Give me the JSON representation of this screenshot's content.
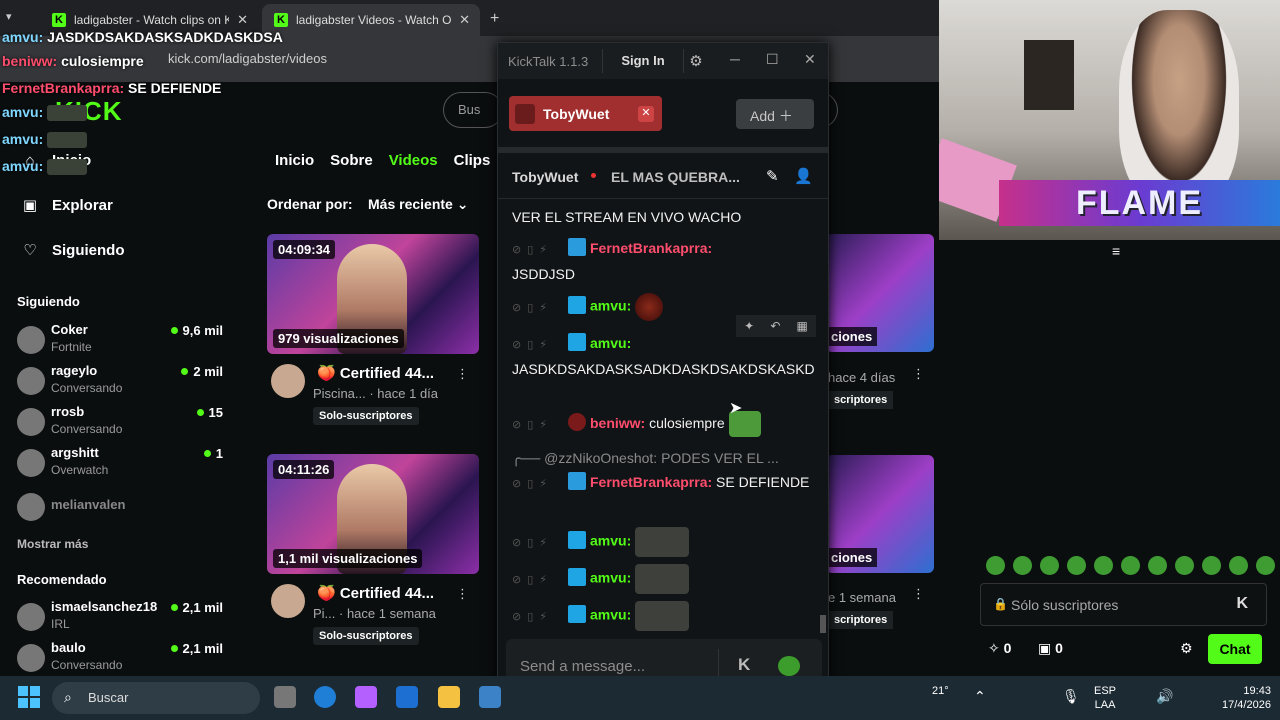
{
  "browser": {
    "tabs": [
      {
        "title": "ladigabster - Watch clips on Kic"
      },
      {
        "title": "ladigabster Videos - Watch On"
      }
    ],
    "new_tab": "+",
    "url": "kick.com/ladigabster/videos"
  },
  "overlay_chat": [
    {
      "user": "amvu:",
      "text": "JASDKDSAKDASKSADKDASKDSA"
    },
    {
      "user": "beniww:",
      "text": "culosiempre"
    },
    {
      "user": "FernetBrankaprra:",
      "text": "SE DEFIENDE"
    },
    {
      "user": "amvu:",
      "text": ""
    },
    {
      "user": "amvu:",
      "text": ""
    },
    {
      "user": "amvu:",
      "text": ""
    }
  ],
  "kick": {
    "logo": "KICK",
    "search_placeholder": "Bus",
    "nav": [
      {
        "label": "Inicio",
        "icon": "home-icon"
      },
      {
        "label": "Explorar",
        "icon": "compass-icon"
      },
      {
        "label": "Siguiendo",
        "icon": "heart-icon"
      }
    ],
    "following_header": "Siguiendo",
    "following": [
      {
        "name": "Coker",
        "sub": "Fortnite",
        "count": "9,6 mil"
      },
      {
        "name": "rageylo",
        "sub": "Conversando",
        "count": "2 mil"
      },
      {
        "name": "rrosb",
        "sub": "Conversando",
        "count": "15"
      },
      {
        "name": "argshitt",
        "sub": "Overwatch",
        "count": "1"
      },
      {
        "name": "melianvalen",
        "sub": "",
        "count": ""
      }
    ],
    "show_more": "Mostrar más",
    "recommended_header": "Recomendado",
    "recommended": [
      {
        "name": "ismaelsanchez18",
        "sub": "IRL",
        "count": "2,1 mil"
      },
      {
        "name": "baulo",
        "sub": "Conversando",
        "count": "2,1 mil"
      }
    ],
    "profile_tabs": [
      "Inicio",
      "Sobre",
      "Videos",
      "Clips"
    ],
    "sort_label": "Ordenar por:",
    "sort_value": "Más reciente",
    "videos": [
      {
        "duration": "04:09:34",
        "views": "979 visualizaciones",
        "title": "🍑 Certified 44...",
        "meta": "Piscina... · hace 1 día",
        "badge": "Solo-suscriptores"
      },
      {
        "duration": "04:11:26",
        "views": "1,1 mil visualizaciones",
        "title": "🍑 Certified 44...",
        "meta": "Pi... · hace 1 semana",
        "badge": "Solo-suscriptores"
      }
    ],
    "right_videos": [
      {
        "views": "ciones",
        "meta": "hace 4 días",
        "badge": "scriptores"
      },
      {
        "views": "ciones",
        "meta": "e 1 semana",
        "badge": "scriptores"
      }
    ]
  },
  "kicktalk": {
    "title": "KickTalk 1.1.3",
    "sign_in": "Sign In",
    "channel_tab": "TobyWuet",
    "add_label": "Add",
    "streamer": "TobyWuet",
    "stream_title": "EL MAS QUEBRA...",
    "messages": [
      {
        "text": "VER EL STREAM EN VIVO WACHO"
      },
      {
        "user": "FernetBrankaprra:",
        "text": "JSDDJSD"
      },
      {
        "user": "amvu:",
        "text": ""
      },
      {
        "user": "amvu:",
        "text": "JASDKDSAKDASKSADKDASKDSAKDSKASKD"
      },
      {
        "user": "beniww:",
        "text": "culosiempre"
      },
      {
        "reply": "@zzNikoOneshot: PODES VER EL ..."
      },
      {
        "user": "FernetBrankaprra:",
        "text": "SE DEFIENDE"
      },
      {
        "user": "amvu:",
        "text": ""
      },
      {
        "user": "amvu:",
        "text": ""
      },
      {
        "user": "amvu:",
        "text": ""
      }
    ],
    "input_placeholder": "Send a message..."
  },
  "webcam": {
    "banner": "FLAME"
  },
  "right_chat": {
    "input_placeholder": "Sólo suscriptores",
    "stat1": "0",
    "stat2": "0",
    "chat_button": "Chat"
  },
  "taskbar": {
    "search": "Buscar",
    "temp": "21°",
    "lang": "ESP",
    "layout": "LAA",
    "time": "19:43",
    "date": "17/4/2026"
  },
  "colors": {
    "kick_green": "#53fc18",
    "username_red": "#ff4d6d",
    "tab_red": "#a22f2f"
  }
}
